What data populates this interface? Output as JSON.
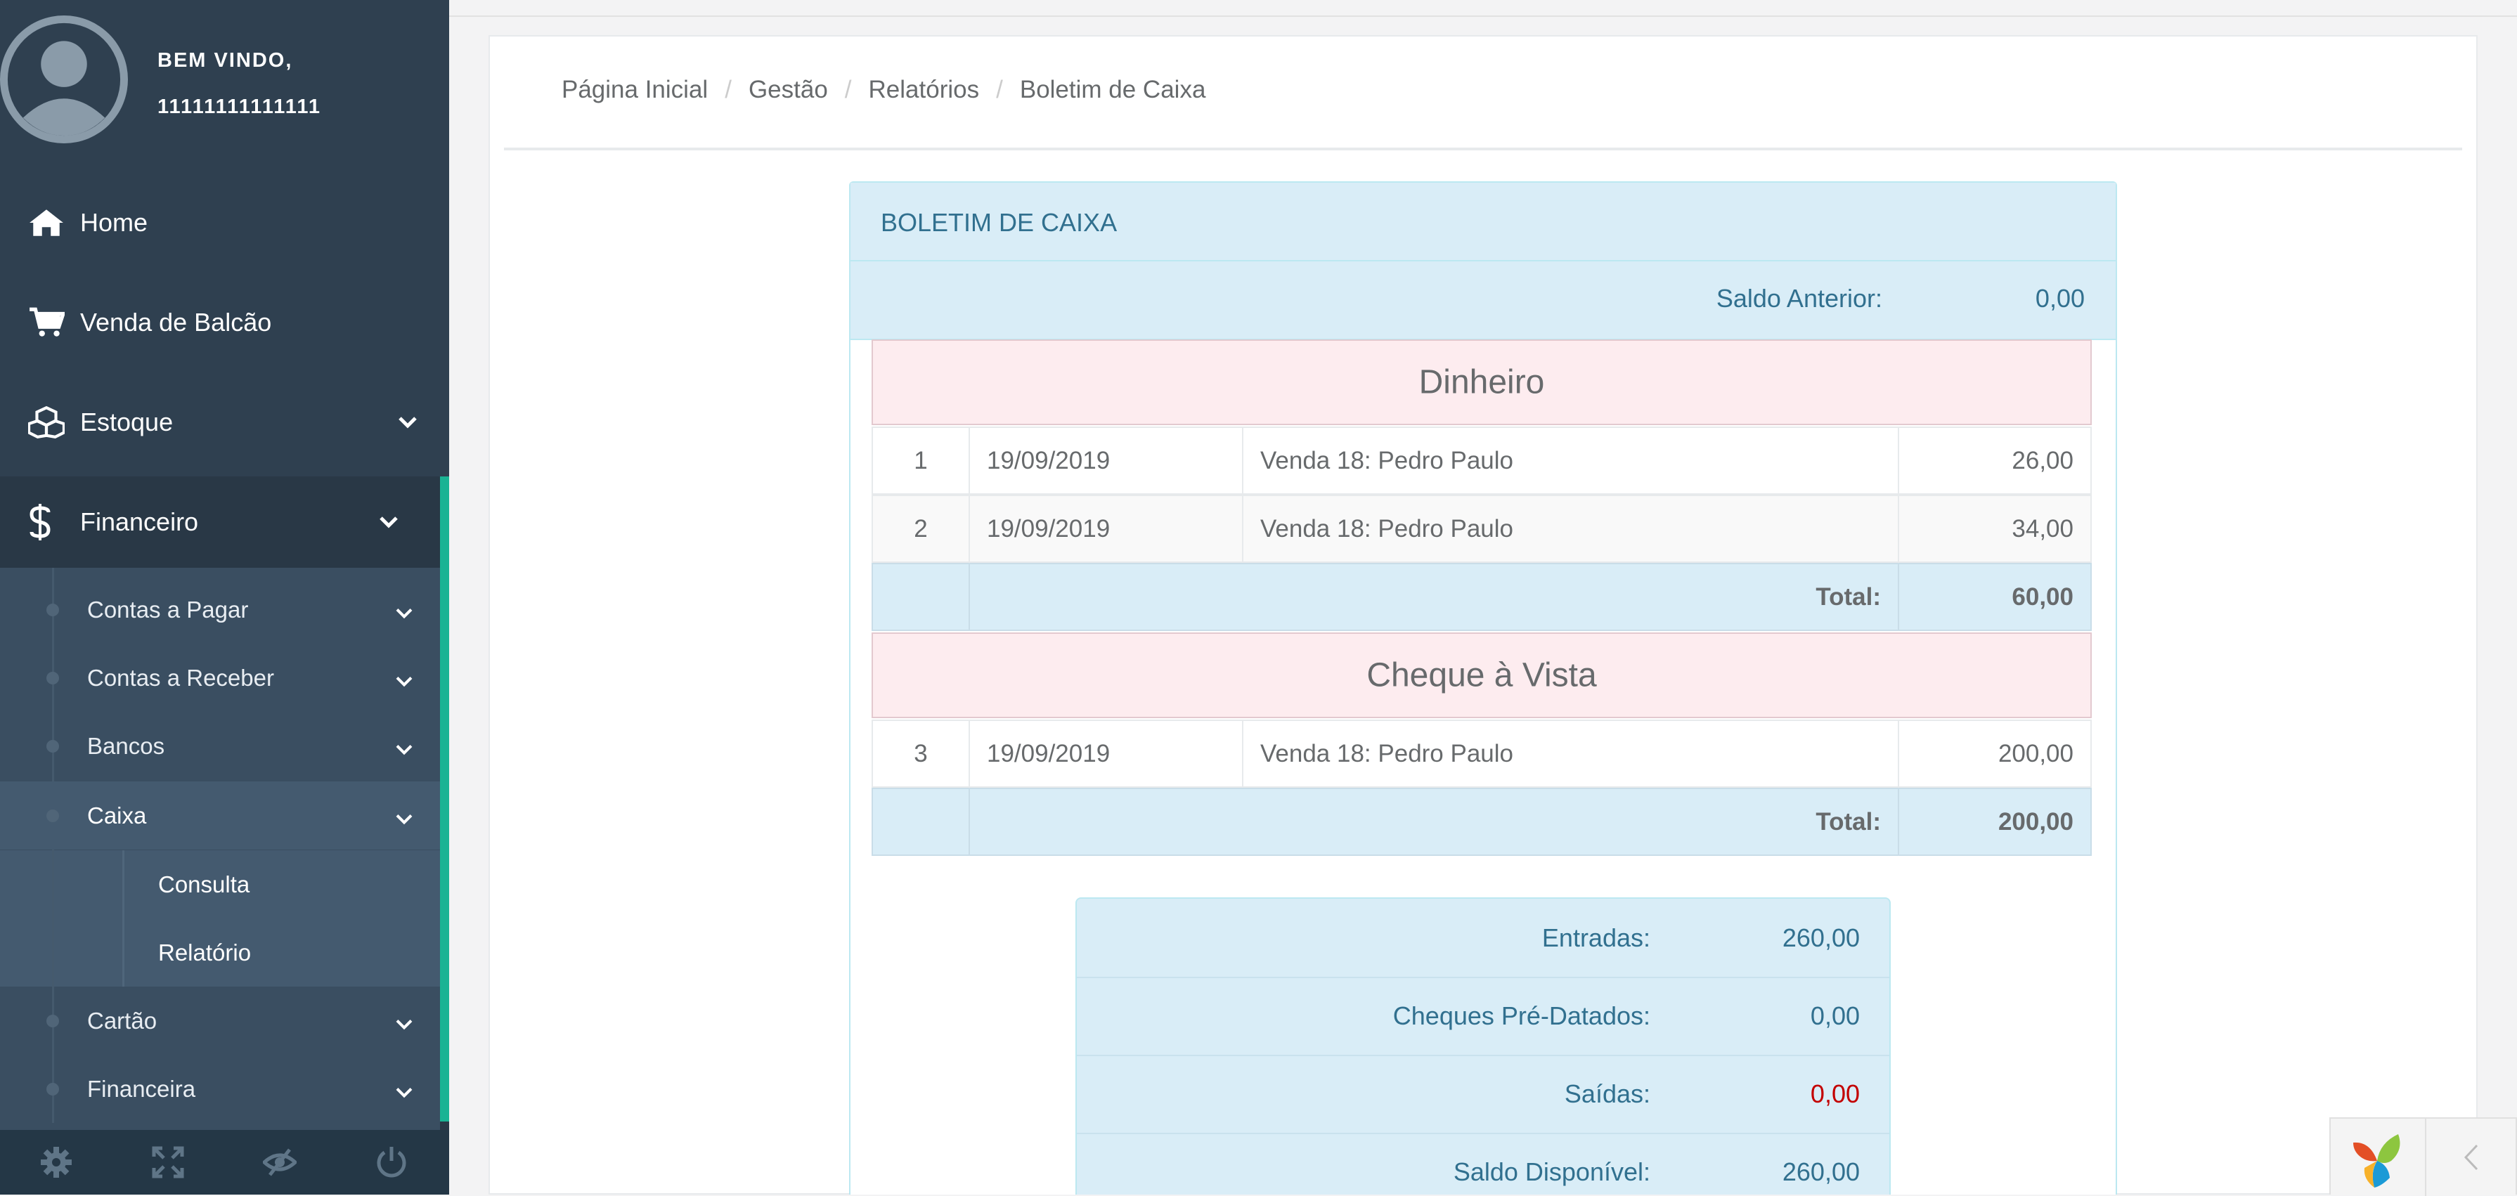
{
  "sidebar": {
    "welcome": "BEM VINDO,",
    "username": "11111111111111",
    "nav": [
      {
        "label": "Home",
        "icon": "home-icon"
      },
      {
        "label": "Venda de Balcão",
        "icon": "shopping-cart-icon"
      },
      {
        "label": "Estoque",
        "icon": "cubes-icon"
      },
      {
        "label": "Financeiro",
        "icon": "dollar-icon"
      }
    ],
    "financeiro_items": [
      {
        "label": "Contas a Pagar"
      },
      {
        "label": "Contas a Receber"
      },
      {
        "label": "Bancos"
      },
      {
        "label": "Caixa"
      },
      {
        "label": "Cartão"
      },
      {
        "label": "Financeira"
      }
    ],
    "caixa_items": [
      {
        "label": "Consulta"
      },
      {
        "label": "Relatório"
      }
    ],
    "footer_icons": [
      "gear-icon",
      "expand-icon",
      "eye-slash-icon",
      "power-icon"
    ]
  },
  "breadcrumb": [
    "Página Inicial",
    "Gestão",
    "Relatórios",
    "Boletim de Caixa"
  ],
  "report": {
    "title": "BOLETIM DE CAIXA",
    "saldo_anterior_label": "Saldo Anterior:",
    "saldo_anterior_value": "0,00",
    "sections": [
      {
        "name": "Dinheiro",
        "rows": [
          {
            "num": "1",
            "date": "19/09/2019",
            "desc": "Venda 18: Pedro Paulo",
            "value": "26,00"
          },
          {
            "num": "2",
            "date": "19/09/2019",
            "desc": "Venda 18: Pedro Paulo",
            "value": "34,00"
          }
        ],
        "total_label": "Total:",
        "total_value": "60,00"
      },
      {
        "name": "Cheque à Vista",
        "rows": [
          {
            "num": "3",
            "date": "19/09/2019",
            "desc": "Venda 18: Pedro Paulo",
            "value": "200,00"
          }
        ],
        "total_label": "Total:",
        "total_value": "200,00"
      }
    ],
    "summary": [
      {
        "label": "Entradas:",
        "value": "260,00"
      },
      {
        "label": "Cheques Pré-Datados:",
        "value": "0,00"
      },
      {
        "label": "Saídas:",
        "value": "0,00"
      },
      {
        "label": "Saldo Disponível:",
        "value": "260,00"
      }
    ]
  },
  "colors": {
    "sidebar_bg": "#2f4050",
    "accent": "#1ab394",
    "info_bg": "#d9edf7",
    "info_text": "#31708f",
    "section_bg": "#fdecef",
    "negative": "#c30000"
  },
  "widget": {
    "logo_icon": "yii-logo-icon",
    "toggle_icon": "chevron-left-icon"
  }
}
